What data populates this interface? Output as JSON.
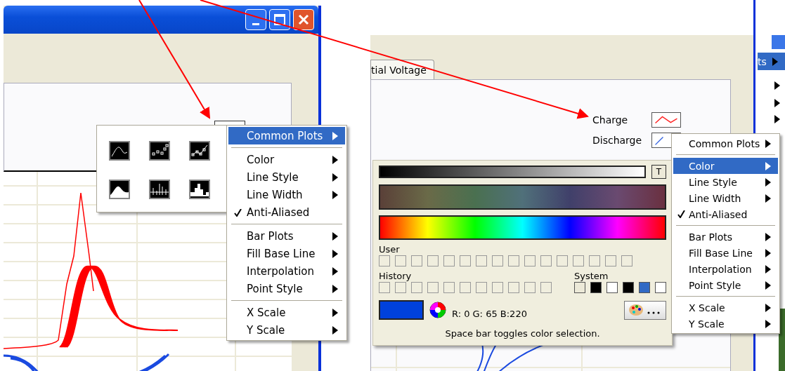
{
  "left_window": {
    "palette_popup": {
      "icons": [
        {
          "kind": "line"
        },
        {
          "kind": "points"
        },
        {
          "kind": "line-points"
        },
        {
          "kind": "fill"
        },
        {
          "kind": "bars"
        },
        {
          "kind": "steps"
        }
      ]
    },
    "context_menu": {
      "groups": [
        [
          {
            "label": "Common Plots",
            "kind": "submenu",
            "selected": true
          }
        ],
        [
          {
            "label": "Color",
            "kind": "submenu",
            "selected": false
          },
          {
            "label": "Line Style",
            "kind": "submenu",
            "selected": false
          },
          {
            "label": "Line Width",
            "kind": "submenu",
            "selected": false
          },
          {
            "label": "Anti-Aliased",
            "kind": "toggle",
            "selected": false,
            "checked": true
          }
        ],
        [
          {
            "label": "Bar Plots",
            "kind": "submenu",
            "selected": false
          },
          {
            "label": "Fill Base Line",
            "kind": "submenu",
            "selected": false
          },
          {
            "label": "Interpolation",
            "kind": "submenu",
            "selected": false
          },
          {
            "label": "Point Style",
            "kind": "submenu",
            "selected": false
          }
        ],
        [
          {
            "label": "X Scale",
            "kind": "submenu",
            "selected": false
          },
          {
            "label": "Y Scale",
            "kind": "submenu",
            "selected": false
          }
        ]
      ]
    }
  },
  "right_window": {
    "tab": {
      "label": "tial Voltage"
    },
    "background_menu": {
      "label": "ts"
    },
    "legend": [
      {
        "label": "Charge",
        "color": "#ff2020"
      },
      {
        "label": "Discharge",
        "color": "#3060e0"
      }
    ],
    "color_picker": {
      "transparent_button": "T",
      "user_label": "User",
      "history_label": "History",
      "system_label": "System",
      "system_swatches": [
        {
          "color": "#ece9d8"
        },
        {
          "color": "#000000"
        },
        {
          "color": "#ffffff"
        },
        {
          "color": "#000000"
        },
        {
          "color": "#316ac5"
        },
        {
          "color": "#ffffff"
        }
      ],
      "current": {
        "color": "#0041dc"
      },
      "rgb_reading": "R:  0 G: 65 B:220",
      "hint": "Space bar toggles color selection."
    },
    "context_menu": {
      "groups": [
        [
          {
            "label": "Common Plots",
            "kind": "submenu",
            "selected": false
          }
        ],
        [
          {
            "label": "Color",
            "kind": "submenu",
            "selected": true
          },
          {
            "label": "Line Style",
            "kind": "submenu",
            "selected": false
          },
          {
            "label": "Line Width",
            "kind": "submenu",
            "selected": false
          },
          {
            "label": "Anti-Aliased",
            "kind": "toggle",
            "selected": false,
            "checked": true
          }
        ],
        [
          {
            "label": "Bar Plots",
            "kind": "submenu",
            "selected": false
          },
          {
            "label": "Fill Base Line",
            "kind": "submenu",
            "selected": false
          },
          {
            "label": "Interpolation",
            "kind": "submenu",
            "selected": false
          },
          {
            "label": "Point Style",
            "kind": "submenu",
            "selected": false
          }
        ],
        [
          {
            "label": "X Scale",
            "kind": "submenu",
            "selected": false
          },
          {
            "label": "Y Scale",
            "kind": "submenu",
            "selected": false
          }
        ]
      ]
    }
  }
}
